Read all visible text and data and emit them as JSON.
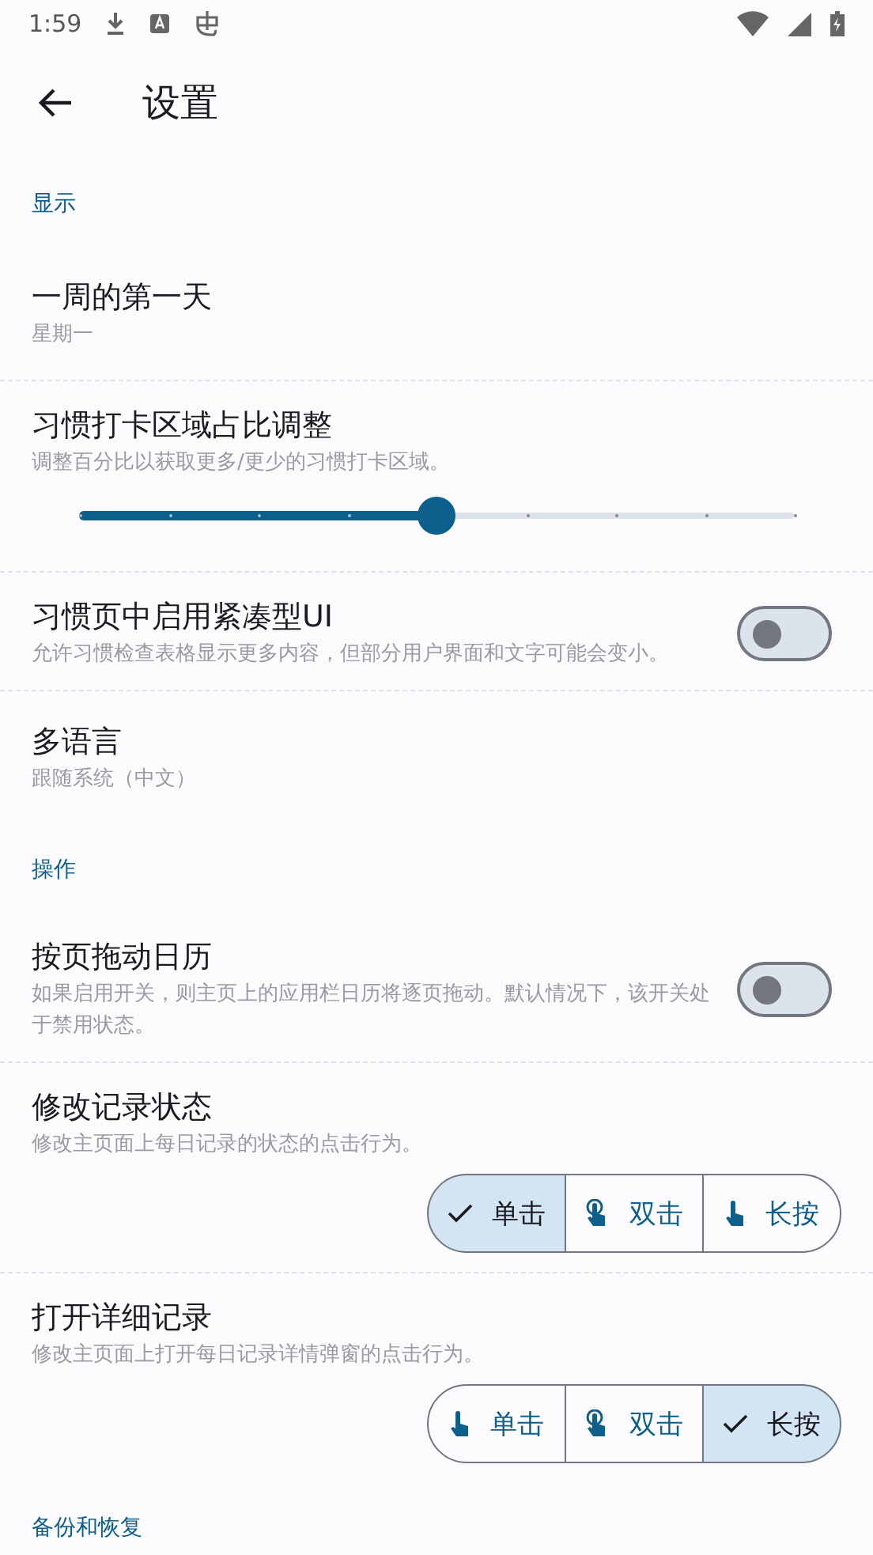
{
  "status_bar": {
    "time": "1:59"
  },
  "app_bar": {
    "title": "设置"
  },
  "sections": [
    {
      "header": "显示",
      "items": [
        {
          "kind": "plain",
          "title": "一周的第一天",
          "subtitle": "星期一"
        },
        {
          "kind": "slider",
          "title": "习惯打卡区域占比调整",
          "subtitle": "调整百分比以获取更多/更少的习惯打卡区域。",
          "level": 0.5
        },
        {
          "kind": "switch",
          "title": "习惯页中启用紧凑型UI",
          "subtitle": "允许习惯检查表格显示更多内容，但部分用户界面和文字可能会变小。",
          "on": false
        },
        {
          "kind": "plain",
          "title": "多语言",
          "subtitle": "跟随系统（中文）"
        }
      ]
    },
    {
      "header": "操作",
      "items": [
        {
          "kind": "switch",
          "title": "按页拖动日历",
          "subtitle": "如果启用开关，则主页上的应用栏日历将逐页拖动。默认情况下，该开关处于禁用状态。",
          "on": false
        },
        {
          "kind": "segmented",
          "title": "修改记录状态",
          "subtitle": "修改主页面上每日记录的状态的点击行为。",
          "segments": [
            {
              "label": "单击",
              "selected": true
            },
            {
              "label": "双击",
              "selected": false
            },
            {
              "label": "长按",
              "selected": false
            }
          ]
        },
        {
          "kind": "segmented",
          "title": "打开详细记录",
          "subtitle": "修改主页面上打开每日记录详情弹窗的点击行为。",
          "segments": [
            {
              "label": "单击",
              "selected": false
            },
            {
              "label": "双击",
              "selected": false
            },
            {
              "label": "长按",
              "selected": true
            }
          ]
        }
      ]
    },
    {
      "header": "备份和恢复"
    }
  ]
}
